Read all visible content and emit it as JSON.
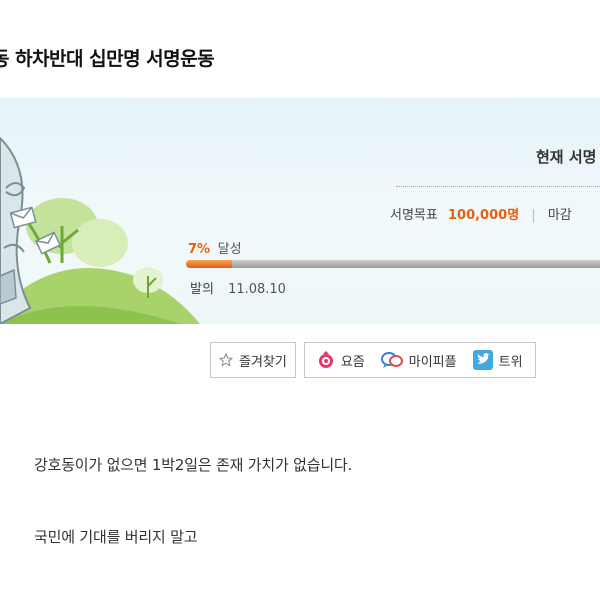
{
  "petition": {
    "title": "동 하차반대 십만명 서명운동"
  },
  "status": {
    "current_label": "현재 서명",
    "goal_label": "서명목표",
    "goal_value": "100,000명",
    "goal_separator": "|",
    "deadline_label": "마감",
    "progress_percent_text": "7%",
    "progress_suffix": "달성",
    "progress_fraction": 0.07,
    "start_label": "발의",
    "start_date": "11.08.10"
  },
  "toolbar": {
    "bookmark_label": "즐겨찾기",
    "yozm_label": "요즘",
    "mypeople_label": "마이피플",
    "twitter_label": "트위"
  },
  "content": {
    "line1": "강호동이가 없으면 1박2일은 존재 가치가 없습니다.",
    "line2": "국민에 기대를 버리지 말고"
  },
  "colors": {
    "accent": "#e8600f",
    "banner_bg": "#e6f3f8",
    "hill_green": "#9ccd5c",
    "twitter_blue": "#3fa9e0",
    "yozm_pink": "#e8356b"
  }
}
